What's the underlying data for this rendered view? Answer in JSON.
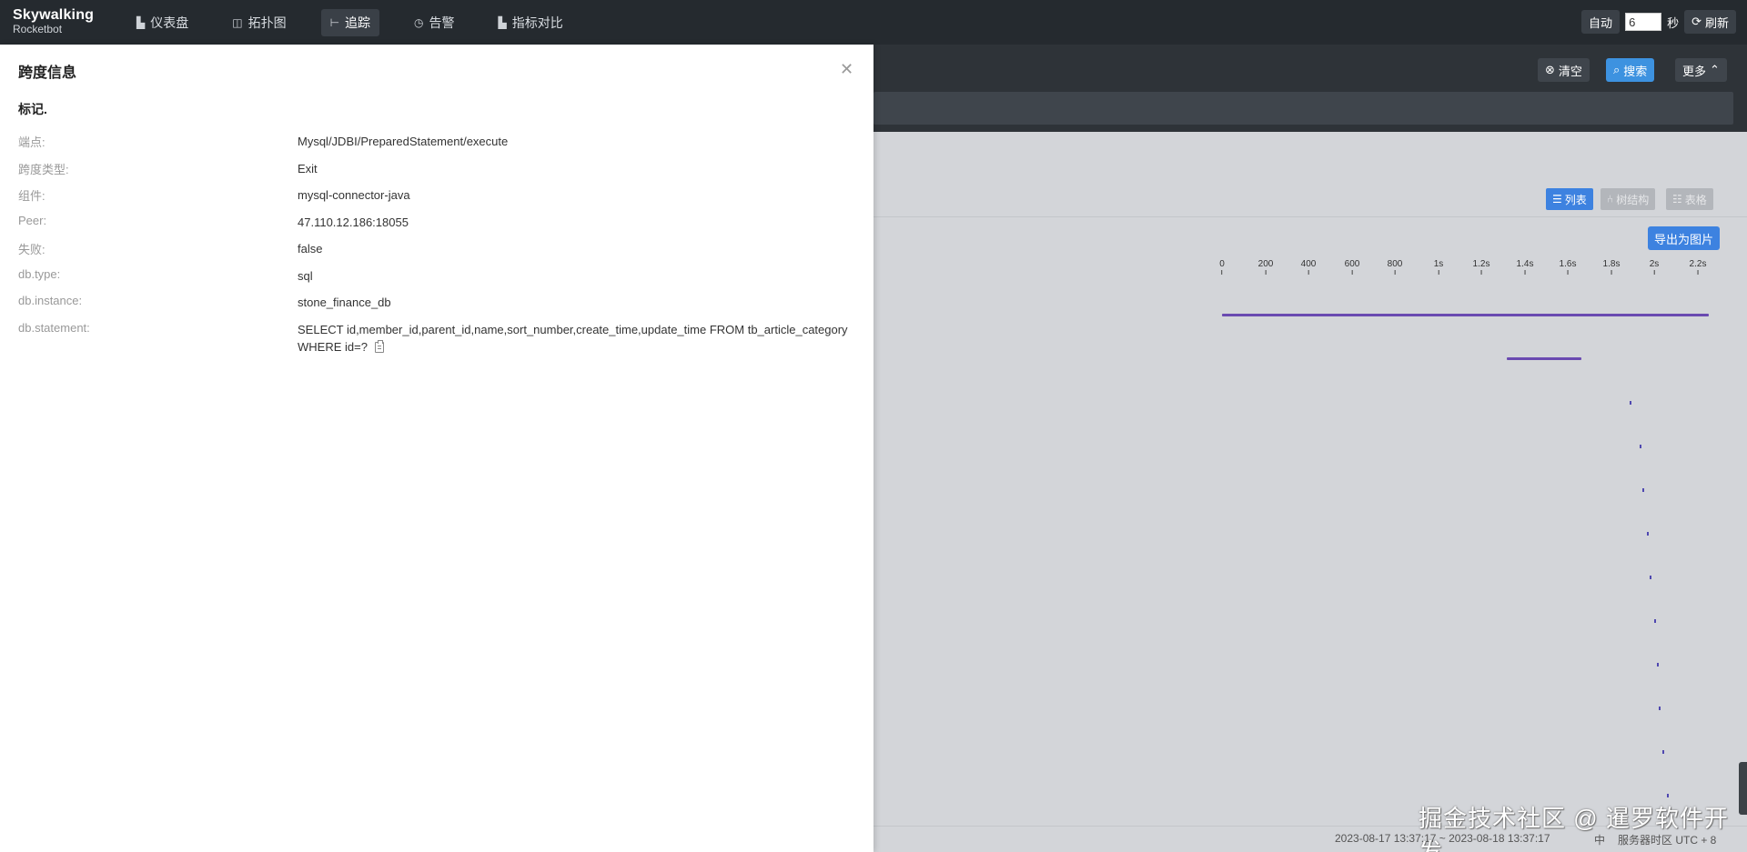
{
  "logo": {
    "line1": "Skywalking",
    "line2": "Rocketbot"
  },
  "nav": {
    "items": [
      {
        "label": "仪表盘",
        "icon": "dashboard-icon"
      },
      {
        "label": "拓扑图",
        "icon": "topology-icon"
      },
      {
        "label": "追踪",
        "icon": "trace-icon",
        "active": true
      },
      {
        "label": "告警",
        "icon": "alarm-icon"
      },
      {
        "label": "指标对比",
        "icon": "compare-icon"
      }
    ]
  },
  "toolbar": {
    "auto_label": "自动",
    "interval_value": "6",
    "interval_unit": "秒",
    "refresh_label": "刷新"
  },
  "filters": {
    "clear_label": "清空",
    "search_label": "搜索",
    "more_label": "更多"
  },
  "trace_view": {
    "list_label": "列表",
    "tree_label": "树结构",
    "table_label": "表格",
    "export_label": "导出为图片",
    "axis_ticks": [
      "0",
      "200",
      "400",
      "600",
      "800",
      "1s",
      "1.2s",
      "1.4s",
      "1.6s",
      "1.8s",
      "2s",
      "2.2s"
    ]
  },
  "drawer": {
    "title": "跨度信息",
    "section_label": "标记.",
    "rows": [
      {
        "key": "端点:",
        "value": "Mysql/JDBI/PreparedStatement/execute"
      },
      {
        "key": "跨度类型:",
        "value": "Exit"
      },
      {
        "key": "组件:",
        "value": "mysql-connector-java"
      },
      {
        "key": "Peer:",
        "value": "47.110.12.186:18055"
      },
      {
        "key": "失败:",
        "value": "false"
      },
      {
        "key": "db.type:",
        "value": "sql"
      },
      {
        "key": "db.instance:",
        "value": "stone_finance_db"
      },
      {
        "key": "db.statement:",
        "value": "SELECT id,member_id,parent_id,name,sort_number,create_time,update_time FROM tb_article_category WHERE id=?"
      }
    ]
  },
  "footer": {
    "time_range": "2023-08-17 13:37:17 ~ 2023-08-18 13:37:17",
    "lang": "中",
    "timezone": "服务器时区 UTC + 8"
  },
  "watermark": "掘金技术社区 @ 暹罗软件开发"
}
